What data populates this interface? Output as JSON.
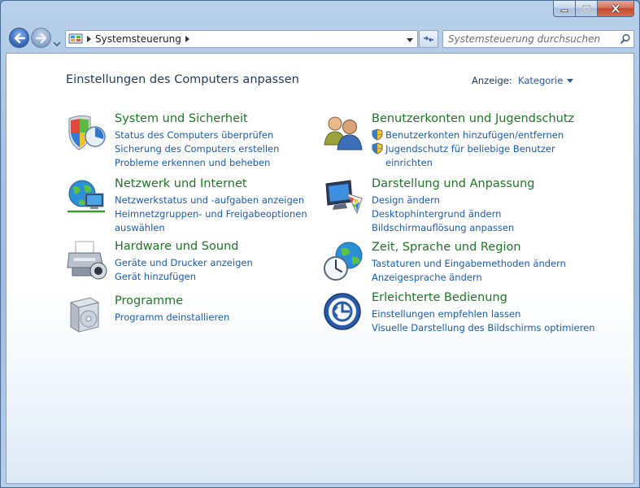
{
  "window": {
    "colors": {
      "accent_green": "#1d7624",
      "link_blue": "#1b5bb0",
      "title_navy": "#1e395b"
    },
    "caption_buttons": [
      "minimize-icon",
      "maximize-icon",
      "close-icon"
    ]
  },
  "navbar": {
    "back_icon": "back-arrow-icon",
    "forward_icon": "forward-arrow-icon",
    "address_breadcrumb": "Systemsteuerung",
    "search_placeholder": "Systemsteuerung durchsuchen"
  },
  "header": {
    "title": "Einstellungen des Computers anpassen",
    "view_label": "Anzeige:",
    "view_value": "Kategorie"
  },
  "categories": [
    {
      "title": "System und Sicherheit",
      "icon": "shield-security-icon",
      "links": [
        "Status des Computers überprüfen",
        "Sicherung des Computers erstellen",
        "Probleme erkennen und beheben"
      ]
    },
    {
      "title": "Netzwerk und Internet",
      "icon": "network-globe-icon",
      "links": [
        "Netzwerkstatus und -aufgaben anzeigen",
        "Heimnetzgruppen- und Freigabeoptionen",
        "auswählen"
      ]
    },
    {
      "title": "Hardware und Sound",
      "icon": "printer-hardware-icon",
      "links": [
        "Geräte und Drucker anzeigen",
        "Gerät hinzufügen"
      ]
    },
    {
      "title": "Programme",
      "icon": "programs-box-icon",
      "links": [
        "Programm deinstallieren"
      ]
    },
    {
      "title": "Benutzerkonten und Jugendschutz",
      "icon": "users-icon",
      "links": [
        "Benutzerkonten hinzufügen/entfernen",
        "Jugendschutz für beliebige Benutzer",
        "einrichten"
      ]
    },
    {
      "title": "Darstellung und Anpassung",
      "icon": "monitor-palette-icon",
      "links": [
        "Design ändern",
        "Desktophintergrund ändern",
        "Bildschirmauflösung anpassen"
      ]
    },
    {
      "title": "Zeit, Sprache und Region",
      "icon": "clock-globe-icon",
      "links": [
        "Tastaturen und Eingabemethoden ändern",
        "Anzeigesprache ändern"
      ]
    },
    {
      "title": "Erleichterte Bedienung",
      "icon": "accessibility-icon",
      "links": [
        "Einstellungen empfehlen lassen",
        "Visuelle Darstellung des Bildschirms optimieren"
      ]
    }
  ]
}
